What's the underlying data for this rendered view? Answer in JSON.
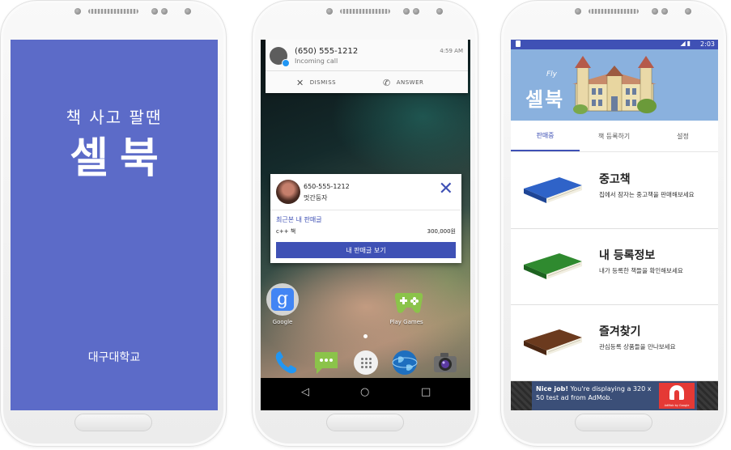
{
  "splash": {
    "tagline": "책 사고 팔땐",
    "app_name": "셀북",
    "school": "대구대학교",
    "bg_color": "#5c6bc8"
  },
  "launcher": {
    "call_notification": {
      "caller": "(650) 555-1212",
      "subtitle": "Incoming call",
      "time": "4:59 AM",
      "dismiss_label": "DISMISS",
      "answer_label": "ANSWER"
    },
    "book_notification": {
      "phone": "650-555-1212",
      "nickname": "멋간둥자",
      "recent_label": "최근본 내 판매글",
      "item_name": "c++ 책",
      "item_price": "300,000원",
      "view_button": "내 판매글 보기",
      "accent": "#3f51b5"
    },
    "apps": [
      {
        "label": "Google",
        "icon": "google-folder-icon"
      },
      {
        "label": "Play Games",
        "icon": "play-games-icon"
      }
    ],
    "dock": [
      "phone-icon",
      "sms-icon",
      "app-drawer-icon",
      "browser-icon",
      "camera-icon"
    ],
    "nav": {
      "back": "◁",
      "home": "○",
      "recent": "□"
    }
  },
  "main_app": {
    "status_time": "2:03",
    "header_title": "셀북",
    "header_deco": "Fly",
    "tabs": [
      "판매중",
      "책 등록하기",
      "설정"
    ],
    "active_tab": 0,
    "menu": [
      {
        "title": "중고책",
        "desc": "집에서 잠자는 중고책을 판매해보세요",
        "book_color": "#2f63c8"
      },
      {
        "title": "내 등록정보",
        "desc": "내가 등록한 책들을 확인해보세요",
        "book_color": "#2f8a2f"
      },
      {
        "title": "즐겨찾기",
        "desc": "관심등록 상품들을 만나보세요",
        "book_color": "#6b3a1e"
      }
    ],
    "ad": {
      "headline": "Nice job!",
      "body": "You're displaying a 320 x 50 test ad from AdMob.",
      "logo_caption": "AdMob by Google"
    },
    "accent": "#3f51b5",
    "header_color": "#8ab1de"
  }
}
